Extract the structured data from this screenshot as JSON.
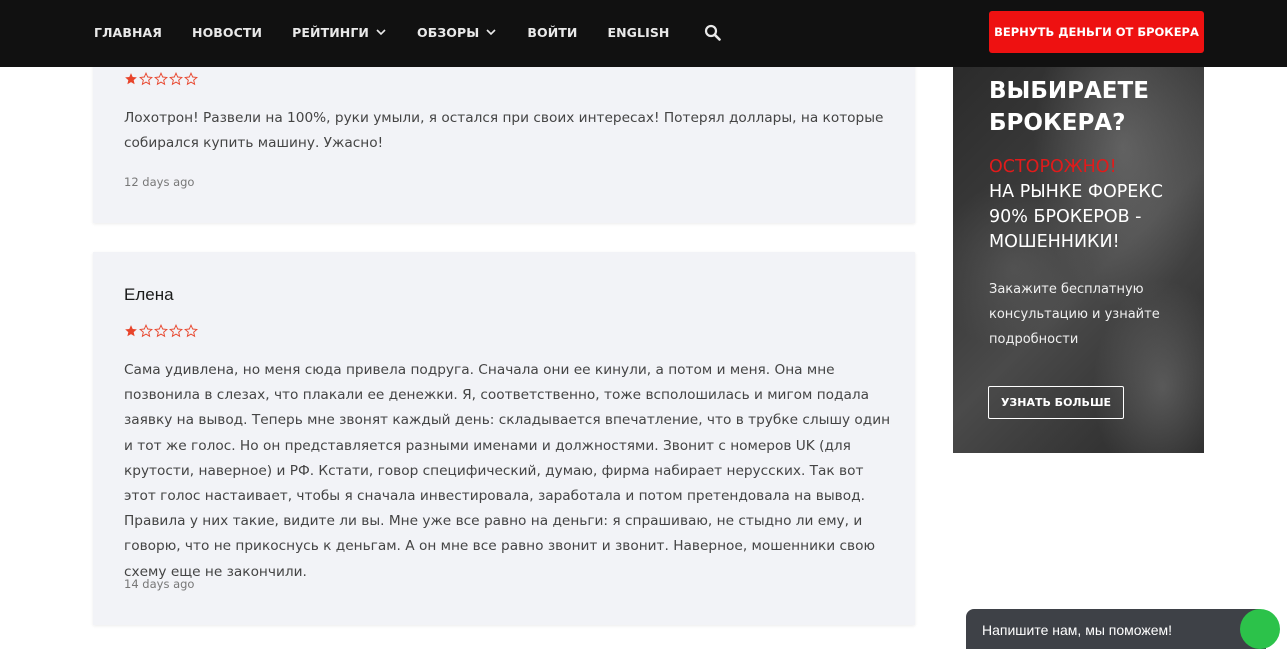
{
  "nav": {
    "items": [
      {
        "label": "ГЛАВНАЯ",
        "dropdown": false
      },
      {
        "label": "НОВОСТИ",
        "dropdown": false
      },
      {
        "label": "РЕЙТИНГИ",
        "dropdown": true
      },
      {
        "label": "ОБЗОРЫ",
        "dropdown": true
      },
      {
        "label": "ВОЙТИ",
        "dropdown": false
      },
      {
        "label": "ENGLISH",
        "dropdown": false
      }
    ],
    "cta_label": "ВЕРНУТЬ ДЕНЬГИ ОТ БРОКЕРА"
  },
  "reviews": [
    {
      "name": "",
      "rating": 1,
      "text": "Лохотрон! Развели на 100%, руки умыли, я остался при своих интересах! Потерял доллары, на которые собирался купить машину. Ужасно!",
      "date": "12 days ago"
    },
    {
      "name": "Елена",
      "rating": 1,
      "text": "Сама удивлена, но меня сюда привела подруга. Сначала они ее кинули, а потом и меня. Она мне позвонила в слезах, что плакали ее денежки. Я, соответственно, тоже всполошилась и мигом подала заявку на вывод. Теперь мне звонят каждый день: складывается впечатление, что в трубке слышу один и тот же голос. Но он представляется разными именами и должностями. Звонит с номеров UK (для крутости, наверное) и РФ. Кстати, говор специфический, думаю, фирма набирает нерусских. Так вот этот голос настаивает, чтобы я сначала инвестировала, заработала и потом претендовала на вывод. Правила у них такие, видите ли вы. Мне уже все равно на деньги: я спрашиваю, не стыдно ли ему, и говорю, что не прикоснусь к деньгам. А он мне все равно звонит и звонит. Наверное, мошенники свою схему еще не закончили.",
      "date": "14 days ago"
    }
  ],
  "banner": {
    "title": "ВЫБИРАЕТЕ БРОКЕРА?",
    "warning": "ОСТОРОЖНО!",
    "text": "НА РЫНКЕ ФОРЕКС 90% БРОКЕРОВ - МОШЕННИКИ!",
    "sub": "Закажите бесплатную консультацию и узнайте подробности",
    "button": "УЗНАТЬ БОЛЬШЕ"
  },
  "chat": {
    "label": "Напишите нам, мы поможем!"
  },
  "colors": {
    "accent_red": "#ee1111",
    "star": "#e8442b",
    "card_bg": "#f2f3f7",
    "nav_bg": "#111111"
  }
}
